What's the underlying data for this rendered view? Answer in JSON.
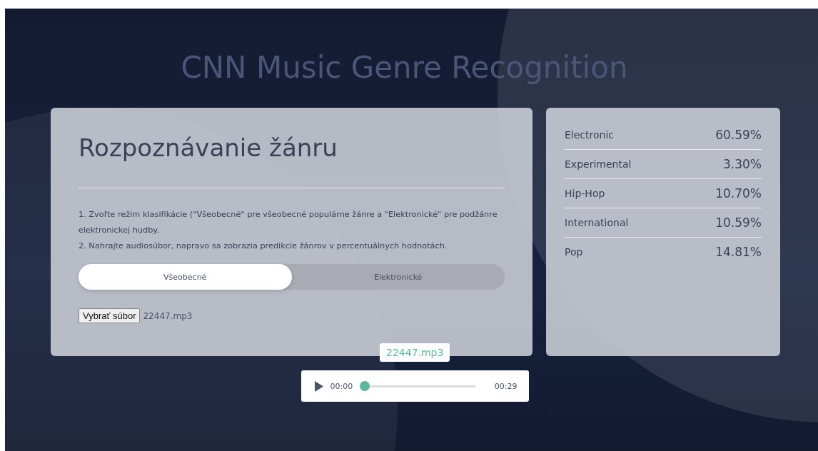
{
  "title": "CNN Music Genre Recognition",
  "card": {
    "heading": "Rozpoznávanie žánru",
    "instructions": [
      "1. Zvoľte režim klasifikácie (\"Všeobecné\" pre všeobecné populárne žánre a \"Elektronické\" pre podžánre elektronickej hudby.",
      "2. Nahrajte audiosúbor, napravo sa zobrazia predikcie žánrov v percentuálnych hodnotách."
    ],
    "modes": [
      {
        "label": "Všeobecné",
        "selected": true
      },
      {
        "label": "Elektronické",
        "selected": false
      }
    ],
    "file_button": "Vybrať súbor",
    "file_name": "22447.mp3"
  },
  "predictions": [
    {
      "genre": "Electronic",
      "value": "60.59%"
    },
    {
      "genre": "Experimental",
      "value": "3.30%"
    },
    {
      "genre": "Hip-Hop",
      "value": "10.70%"
    },
    {
      "genre": "International",
      "value": "10.59%"
    },
    {
      "genre": "Pop",
      "value": "14.81%"
    }
  ],
  "player": {
    "file_label": "22447.mp3",
    "current": "00:00",
    "duration": "00:29",
    "level": 0
  }
}
